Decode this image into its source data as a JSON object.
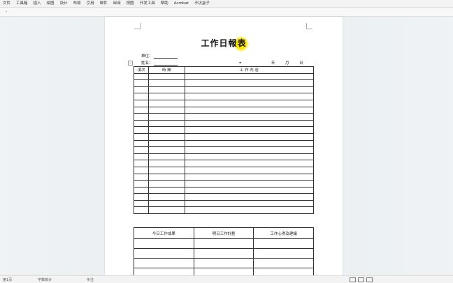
{
  "menu": [
    "文件",
    "工具箱",
    "插入",
    "绘图",
    "设计",
    "布局",
    "引用",
    "邮件",
    "审阅",
    "视图",
    "开发工具",
    "帮助",
    "Acrobat",
    "不坑盒子"
  ],
  "ribbon": {
    "collapse_glyph": "›"
  },
  "document": {
    "title": "工作日報表",
    "unit_label": "單位：",
    "name_label": "姓名：",
    "date_year": "年",
    "date_month": "月",
    "date_day": "日",
    "table_headers": [
      "項次",
      "時 間",
      "工 作 內 容"
    ],
    "blank_rows": 21,
    "bottom_headers": [
      "今日工作成果",
      "明日工作計劃",
      "工作心得及建議"
    ],
    "bottom_blank_rows": 4
  },
  "status": {
    "page_info": "第1页",
    "words": "字数统计",
    "focus": "专注"
  }
}
